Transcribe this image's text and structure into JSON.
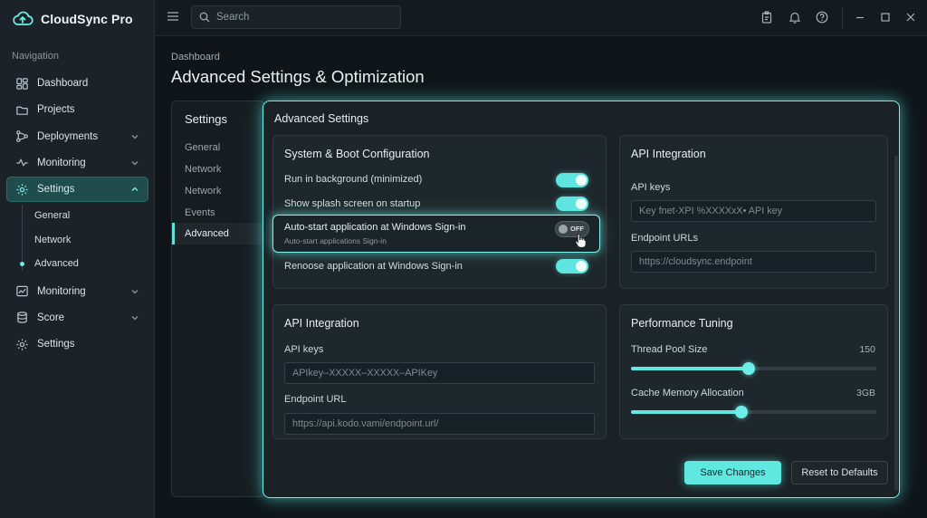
{
  "app": {
    "name": "CloudSync Pro"
  },
  "sidebar": {
    "heading": "Navigation",
    "items": [
      {
        "label": "Dashboard",
        "icon": "dashboard-icon"
      },
      {
        "label": "Projects",
        "icon": "folder-icon"
      },
      {
        "label": "Deployments",
        "icon": "deployments-icon",
        "expandable": true
      },
      {
        "label": "Monitoring",
        "icon": "activity-icon",
        "expandable": true
      },
      {
        "label": "Settings",
        "icon": "gear-icon",
        "expandable": true,
        "active": true
      }
    ],
    "settings_sub": [
      {
        "label": "General"
      },
      {
        "label": "Network"
      },
      {
        "label": "Advanced",
        "active": true
      }
    ],
    "items_after": [
      {
        "label": "Monitoring",
        "icon": "chart-icon",
        "expandable": true
      },
      {
        "label": "Score",
        "icon": "database-icon",
        "expandable": true
      },
      {
        "label": "Settings",
        "icon": "gear-icon"
      }
    ]
  },
  "topbar": {
    "search_placeholder": "Search",
    "icons": [
      "clipboard-icon",
      "bell-icon",
      "help-icon",
      "minimize-icon",
      "maximize-icon",
      "close-icon"
    ]
  },
  "page": {
    "breadcrumb": "Dashboard",
    "title": "Advanced Settings & Optimization"
  },
  "settings_panel": {
    "title": "Settings",
    "items": [
      "General",
      "Network",
      "Network",
      "Events",
      "Advanced"
    ],
    "active_index": 4
  },
  "main": {
    "title": "Advanced Settings",
    "system_boot": {
      "title": "System & Boot Configuration",
      "rows": [
        {
          "label": "Run in background (minimized)",
          "on": true
        },
        {
          "label": "Show splash screen on startup",
          "on": true
        },
        {
          "label": "Auto-start application at Windows Sign-in",
          "sublabel": "Auto-start applications Sign-in",
          "on": false,
          "state_text": "OFF"
        },
        {
          "label": "Renoose application at Windows Sign-in",
          "on": true
        }
      ]
    },
    "api_top": {
      "title": "API Integration",
      "keys_label": "API keys",
      "keys_placeholder": "Key fnet-XPI %XXXXxX• API key",
      "endpoints_label": "Endpoint URLs",
      "endpoints_placeholder": "https://cloudsync.endpoint"
    },
    "api_bottom": {
      "title": "API Integration",
      "keys_label": "API keys",
      "keys_placeholder": "APIkey–XXXXX–XXXXX–APIKey",
      "endpoint_label": "Endpoint URL",
      "endpoint_placeholder": "https://api.kodo.νami/endpoint.url/"
    },
    "performance": {
      "title": "Performance Tuning",
      "thread_label": "Thread Pool Size",
      "thread_value": "150",
      "thread_fraction": 0.48,
      "cache_label": "Cache Memory Allocation",
      "cache_value": "3GB",
      "cache_fraction": 0.45
    },
    "save_label": "Save Changes",
    "reset_label": "Reset to Defaults"
  },
  "colors": {
    "accent": "#5fe8e0",
    "background": "#0f1519",
    "sidebar": "#1b2328",
    "panel": "#1a2226"
  }
}
